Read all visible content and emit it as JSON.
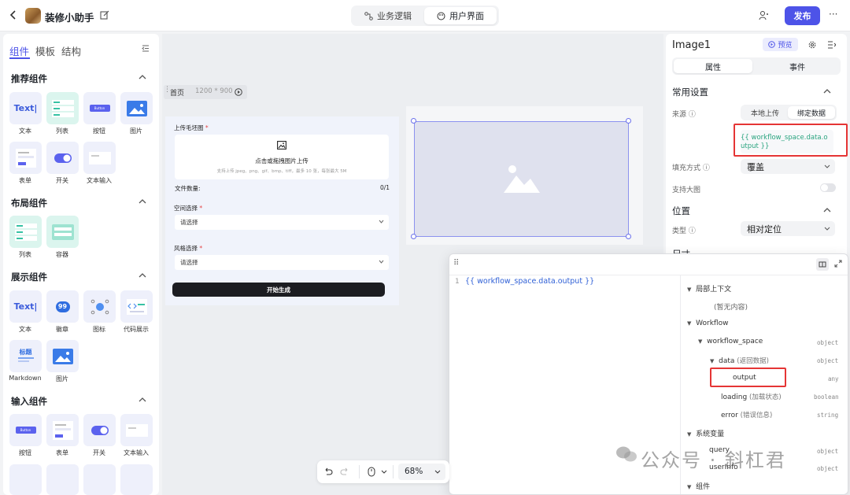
{
  "header": {
    "app_title": "装修小助手",
    "tabs": [
      {
        "label": "业务逻辑"
      },
      {
        "label": "用户界面"
      }
    ],
    "publish_label": "发布",
    "more_label": "···"
  },
  "left_panel": {
    "tabs": [
      "组件",
      "模板",
      "结构"
    ],
    "sections": [
      {
        "title": "推荐组件",
        "items": [
          "文本",
          "列表",
          "按钮",
          "图片",
          "表单",
          "开关",
          "文本输入"
        ]
      },
      {
        "title": "布局组件",
        "items": [
          "列表",
          "容器"
        ]
      },
      {
        "title": "展示组件",
        "items": [
          "文本",
          "徽章",
          "图标",
          "代码展示",
          "Markdown",
          "图片"
        ]
      },
      {
        "title": "输入组件",
        "items": [
          "按钮",
          "表单",
          "开关",
          "文本输入"
        ]
      }
    ],
    "card_text": {
      "text_icon": "Text|",
      "badge_number": "99",
      "button_text": "Button",
      "markdown_title": "标题"
    }
  },
  "canvas": {
    "page_name": "首页",
    "page_size": "1200 * 900",
    "form": {
      "upload_label": "上传毛坯图",
      "upload_hint": "点击或拖拽图片上传",
      "upload_sub": "支持上传 jpeg、png、gif、bmp、tiff，最多 10 张，每张最大 5M",
      "file_count_label": "文件数量:",
      "file_count_value": "0/1",
      "space_label": "空间选择",
      "space_placeholder": "请选择",
      "style_label": "风格选择",
      "style_placeholder": "请选择",
      "generate_label": "开始生成"
    }
  },
  "right_panel": {
    "component_name": "Image1",
    "preview_label": "预览",
    "tabs": [
      "属性",
      "事件"
    ],
    "common_settings": "常用设置",
    "source_label": "来源",
    "source_options": [
      "本地上传",
      "绑定数据"
    ],
    "binding_value": "{{ workflow_space.data.output }}",
    "fill_mode_label": "填充方式",
    "fill_mode_value": "覆盖",
    "enlarge_label": "支持大图",
    "position_title": "位置",
    "type_label": "类型",
    "type_value": "相对定位",
    "size_title": "尺寸"
  },
  "popup": {
    "line_number": "1",
    "code_line": "{{ workflow_space.data.output }}",
    "tree": [
      {
        "label": "局部上下文",
        "type": ""
      },
      {
        "label": "(暂无内容)",
        "type": ""
      },
      {
        "label": "Workflow",
        "type": ""
      },
      {
        "label": "workflow_space",
        "type": "object"
      },
      {
        "label": "data",
        "sub": "(返回数据)",
        "type": "object"
      },
      {
        "label": "output",
        "type": "any"
      },
      {
        "label": "loading",
        "sub": "(加载状态)",
        "type": "boolean"
      },
      {
        "label": "error",
        "sub": "(错误信息)",
        "type": "string"
      },
      {
        "label": "系统变量",
        "type": ""
      },
      {
        "label": "query",
        "type": "object"
      },
      {
        "label": "userInfo",
        "type": "object"
      },
      {
        "label": "组件",
        "type": ""
      }
    ]
  },
  "bottom_toolbar": {
    "zoom": "68%"
  },
  "watermark": "公众号 · 斜杠君",
  "colors": {
    "accent": "#4d53e8",
    "highlight_box": "#e53535",
    "binding_text": "#2aa47f"
  }
}
